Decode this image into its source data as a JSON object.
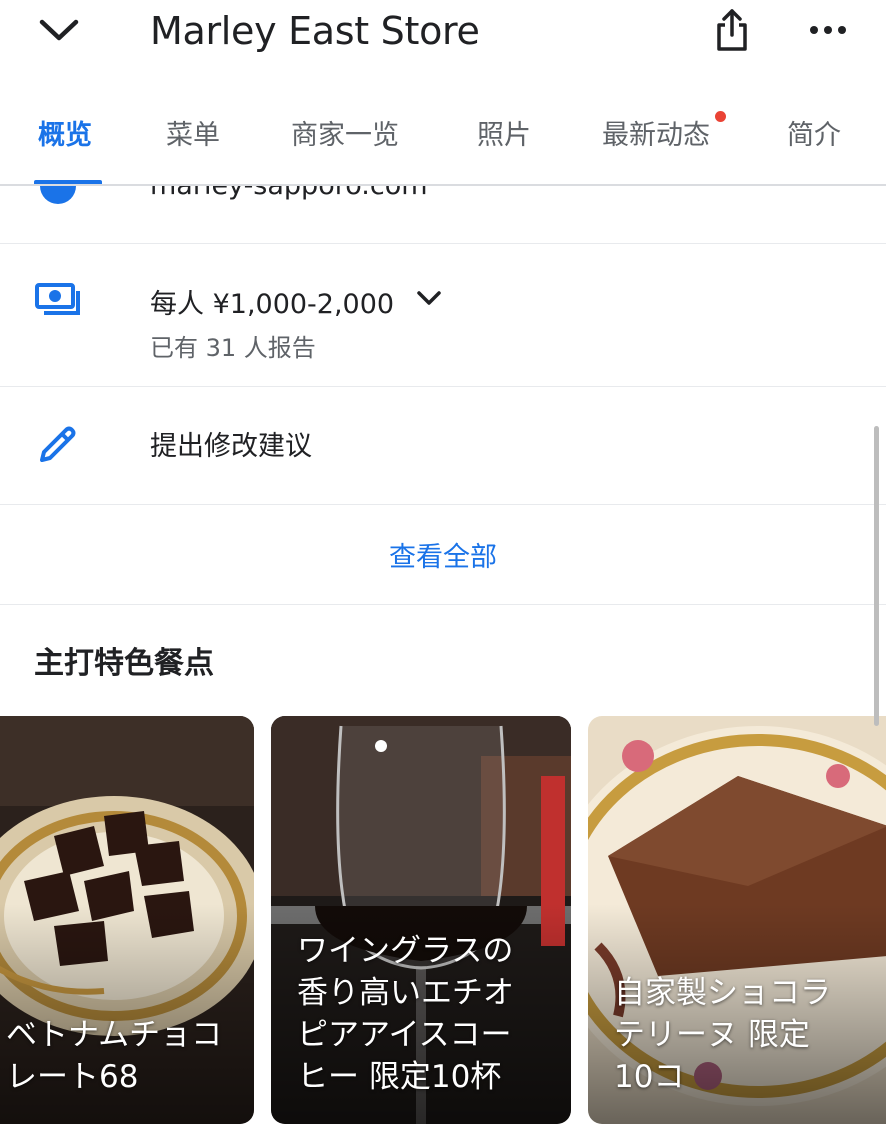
{
  "header": {
    "title": "Marley East Store",
    "back_icon": "chevron-down-icon",
    "share_icon": "share-icon",
    "more_icon": "more-horizontal-icon"
  },
  "tabs": [
    {
      "label": "概览",
      "active": true
    },
    {
      "label": "菜单"
    },
    {
      "label": "商家一览"
    },
    {
      "label": "照片"
    },
    {
      "label": "最新动态",
      "has_dot": true
    },
    {
      "label": "简介"
    }
  ],
  "info": {
    "website": "marley-sapporo.com",
    "price_range": "每人 ¥1,000-2,000",
    "price_reports": "已有 31 人报告",
    "suggest_edit": "提出修改建议",
    "see_all": "查看全部"
  },
  "featured": {
    "title": "主打特色餐点",
    "items": [
      {
        "caption": "ベトナムチョコ\nレート68"
      },
      {
        "caption": "ワイングラスの\n香り高いエチオ\nピアアイスコー\nヒー 限定10杯"
      },
      {
        "caption": "自家製ショコラ\nテリーヌ 限定\n10コ"
      }
    ]
  },
  "colors": {
    "accent": "#1a73e8",
    "notification_dot": "#ea4335"
  }
}
